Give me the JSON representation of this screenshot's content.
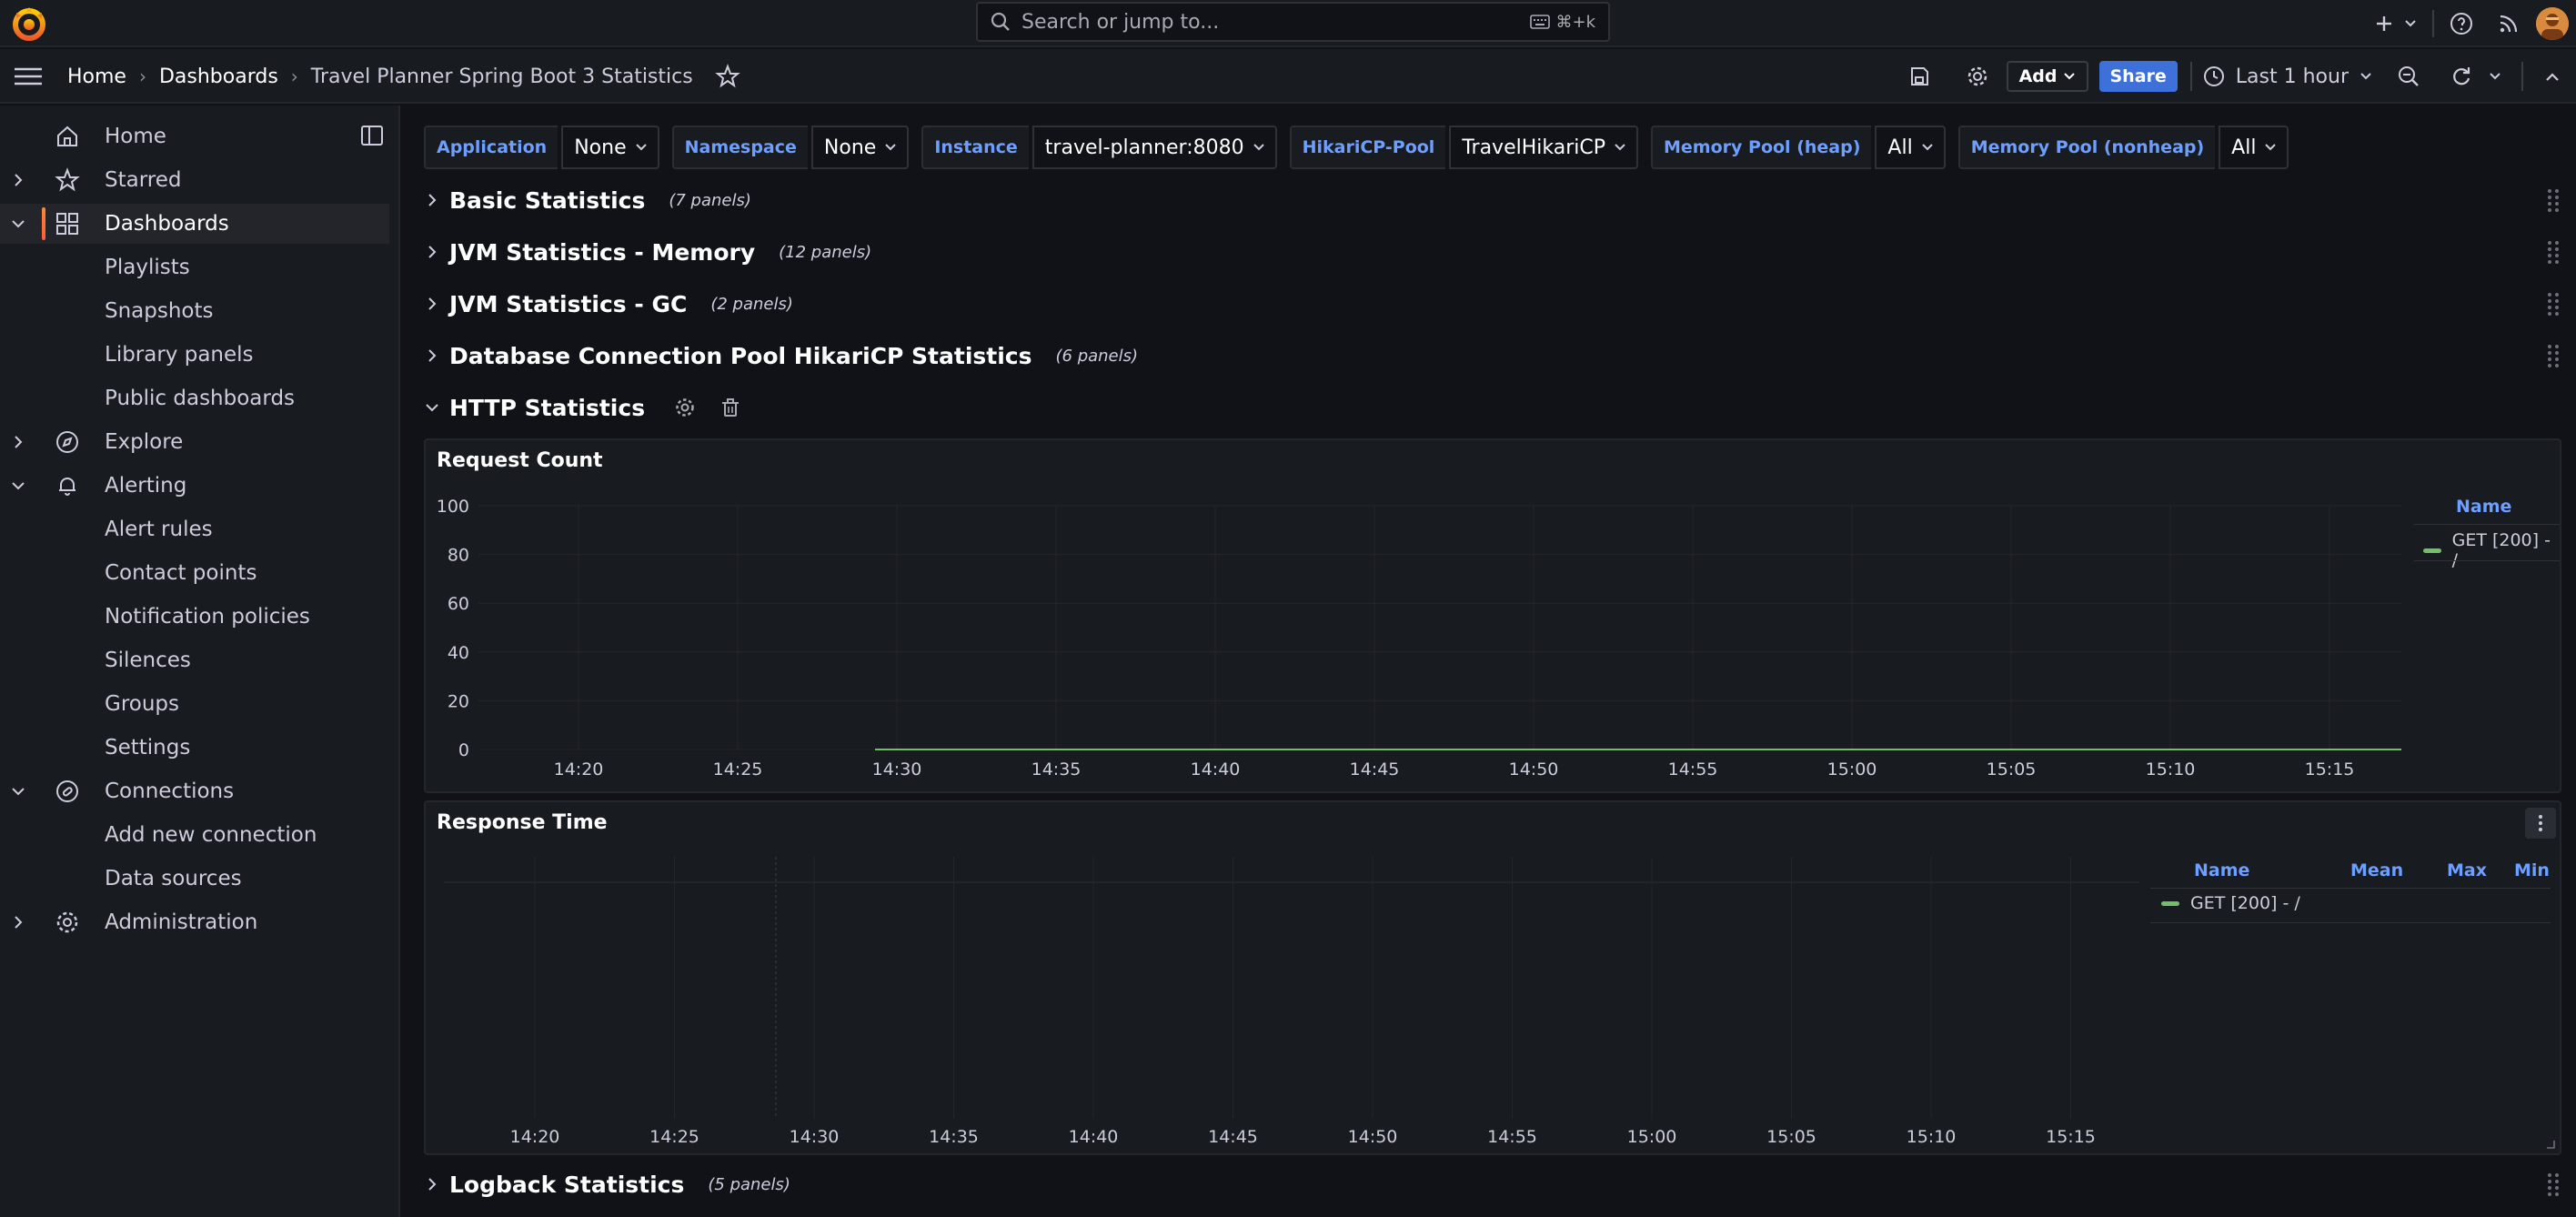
{
  "topbar": {
    "search_placeholder": "Search or jump to...",
    "search_shortcut": "⌘+k",
    "icons": [
      "plus-icon",
      "chevron-down-icon",
      "help-icon",
      "rss-icon",
      "user-avatar"
    ]
  },
  "breadcrumb": {
    "home": "Home",
    "dashboards": "Dashboards",
    "current": "Travel Planner Spring Boot 3 Statistics"
  },
  "toolbar": {
    "add_label": "Add",
    "share_label": "Share",
    "time_range": "Last 1 hour"
  },
  "sidebar": {
    "items": [
      {
        "label": "Home",
        "icon": "home-icon"
      },
      {
        "label": "Starred",
        "icon": "star-icon"
      },
      {
        "label": "Dashboards",
        "icon": "grid-icon"
      },
      {
        "label": "Playlists"
      },
      {
        "label": "Snapshots"
      },
      {
        "label": "Library panels"
      },
      {
        "label": "Public dashboards"
      },
      {
        "label": "Explore",
        "icon": "compass-icon"
      },
      {
        "label": "Alerting",
        "icon": "bell-icon"
      },
      {
        "label": "Alert rules"
      },
      {
        "label": "Contact points"
      },
      {
        "label": "Notification policies"
      },
      {
        "label": "Silences"
      },
      {
        "label": "Groups"
      },
      {
        "label": "Settings"
      },
      {
        "label": "Connections",
        "icon": "link-icon"
      },
      {
        "label": "Add new connection"
      },
      {
        "label": "Data sources"
      },
      {
        "label": "Administration",
        "icon": "gear-icon"
      }
    ]
  },
  "variables": [
    {
      "label": "Application",
      "value": "None"
    },
    {
      "label": "Namespace",
      "value": "None"
    },
    {
      "label": "Instance",
      "value": "travel-planner:8080"
    },
    {
      "label": "HikariCP-Pool",
      "value": "TravelHikariCP"
    },
    {
      "label": "Memory Pool (heap)",
      "value": "All"
    },
    {
      "label": "Memory Pool (nonheap)",
      "value": "All"
    }
  ],
  "rows": [
    {
      "title": "Basic Statistics",
      "count": "(7 panels)"
    },
    {
      "title": "JVM Statistics - Memory",
      "count": "(12 panels)"
    },
    {
      "title": "JVM Statistics - GC",
      "count": "(2 panels)"
    },
    {
      "title": "Database Connection Pool HikariCP Statistics",
      "count": "(6 panels)"
    },
    {
      "title": "HTTP Statistics",
      "count": ""
    },
    {
      "title": "Logback Statistics",
      "count": "(5 panels)"
    }
  ],
  "colors": {
    "series": "#73bf69",
    "accent": "#6e9fff",
    "share": "#3d71d9"
  },
  "chart_data": [
    {
      "type": "line",
      "title": "Request Count",
      "x": [
        "14:20",
        "14:25",
        "14:30",
        "14:35",
        "14:40",
        "14:45",
        "14:50",
        "14:55",
        "15:00",
        "15:05",
        "15:10",
        "15:15"
      ],
      "yticks": [
        "100",
        "80",
        "60",
        "40",
        "20",
        "0"
      ],
      "ylim": [
        0,
        100
      ],
      "grid": true,
      "legend_header": "Name",
      "series": [
        {
          "name": "GET [200] - /",
          "values": [
            null,
            null,
            0,
            0,
            0,
            0,
            0,
            0,
            0,
            0,
            0,
            0
          ]
        }
      ]
    },
    {
      "type": "line",
      "title": "Response Time",
      "x": [
        "14:20",
        "14:25",
        "14:30",
        "14:35",
        "14:40",
        "14:45",
        "14:50",
        "14:55",
        "15:00",
        "15:05",
        "15:10",
        "15:15"
      ],
      "grid": true,
      "legend_header": [
        "Name",
        "Mean",
        "Max",
        "Min"
      ],
      "series": [
        {
          "name": "GET [200] - /",
          "values": []
        }
      ]
    }
  ]
}
